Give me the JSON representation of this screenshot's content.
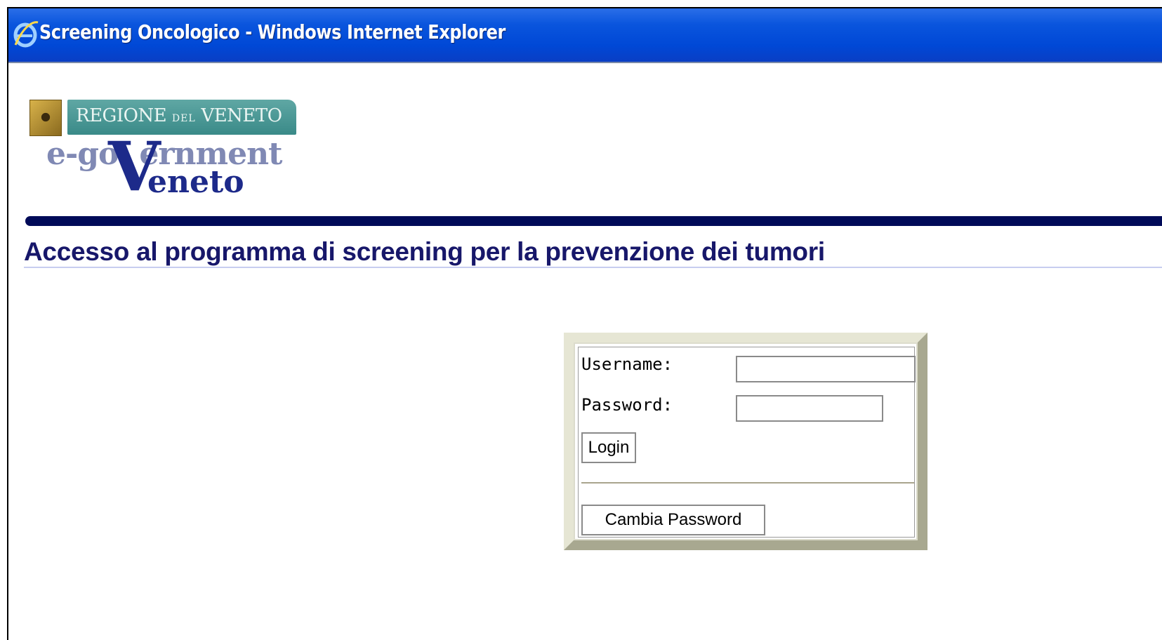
{
  "window": {
    "title": "Screening Oncologico - Windows Internet Explorer",
    "icon": "ie-icon"
  },
  "logo": {
    "region": "REGIONE",
    "region_small": "DEL",
    "region_name": "VENETO",
    "egov": "e-go",
    "egov_rest": "ernment",
    "big_v": "V",
    "veneto": "eneto"
  },
  "page": {
    "heading": "Accesso al programma di screening per la prevenzione dei tumori"
  },
  "login": {
    "username_label": "Username:",
    "username_value": "",
    "password_label": "Password:",
    "password_value": "",
    "login_button": "Login",
    "change_password_button": "Cambia Password"
  },
  "colors": {
    "titlebar": "#0048d6",
    "heading": "#17176a",
    "divider": "#000a58"
  }
}
